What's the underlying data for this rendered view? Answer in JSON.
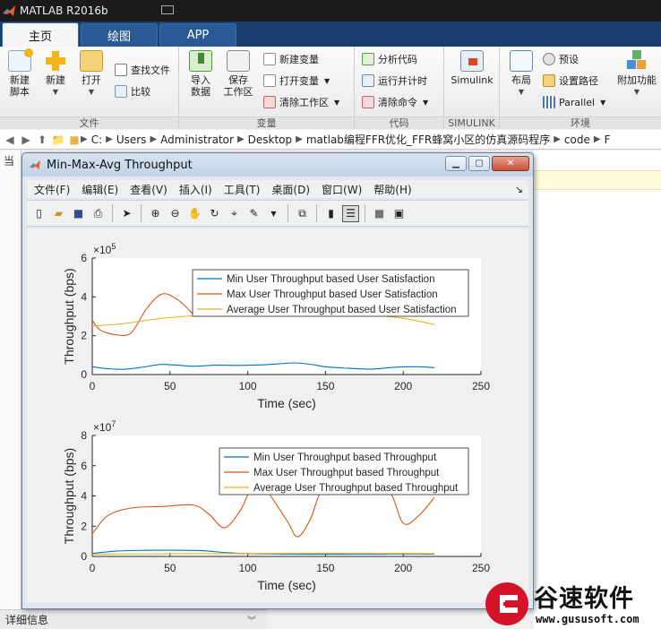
{
  "app": {
    "title": "MATLAB R2016b"
  },
  "ribbon": {
    "tabs": [
      "主页",
      "绘图",
      "APP"
    ],
    "file": {
      "label": "文件",
      "new_script": "新建\n脚本",
      "new": "新建",
      "open": "打开",
      "find_files": "查找文件",
      "compare": "比较"
    },
    "variable": {
      "label": "变量",
      "import": "导入\n数据",
      "save_ws": "保存\n工作区",
      "new_var": "新建变量",
      "open_var": "打开变量",
      "clear_ws": "清除工作区"
    },
    "code": {
      "label": "代码",
      "analyze": "分析代码",
      "run_time": "运行并计时",
      "clear_cmd": "清除命令"
    },
    "simulink": {
      "label": "SIMULINK",
      "button": "Simulink"
    },
    "env": {
      "label": "环境",
      "layout": "布局",
      "prefs": "预设",
      "set_path": "设置路径",
      "parallel": "Parallel",
      "addons": "附加功能"
    }
  },
  "address": {
    "crumbs": [
      "C:",
      "Users",
      "Administrator",
      "Desktop",
      "matlab编程FFR优化_FFR蜂窝小区的仿真源码程序",
      "code",
      "F"
    ]
  },
  "background": {
    "current_folder_label": "当",
    "details": "详细信息"
  },
  "figure": {
    "title": "Min-Max-Avg Throughput",
    "menu": [
      "文件(F)",
      "编辑(E)",
      "查看(V)",
      "插入(I)",
      "工具(T)",
      "桌面(D)",
      "窗口(W)",
      "帮助(H)"
    ]
  },
  "chart_data": [
    {
      "type": "line",
      "xlabel": "Time (sec)",
      "ylabel": "Throughput (bps)",
      "exponent": "×10^5",
      "xlim": [
        0,
        250
      ],
      "ylim": [
        0,
        600000
      ],
      "xticks": [
        0,
        50,
        100,
        150,
        200,
        250
      ],
      "yticks": [
        "0",
        "2",
        "4",
        "6"
      ],
      "legend_position": "top-right",
      "series": [
        {
          "name": "Min User Throughput based User Satisfaction",
          "color": "#0072bd",
          "x": [
            0,
            10,
            20,
            30,
            40,
            45,
            55,
            65,
            80,
            95,
            110,
            120,
            130,
            140,
            150,
            165,
            180,
            195,
            210,
            220
          ],
          "y": [
            40000,
            30000,
            27000,
            35000,
            48000,
            52000,
            48000,
            43000,
            48000,
            47000,
            50000,
            55000,
            60000,
            53000,
            40000,
            32000,
            28000,
            38000,
            40000,
            35000
          ]
        },
        {
          "name": "Max User Throughput based User Satisfaction",
          "color": "#d95319",
          "x": [
            0,
            5,
            15,
            25,
            35,
            45,
            55,
            65
          ],
          "y": [
            280000,
            230000,
            205000,
            215000,
            340000,
            415000,
            385000,
            310000
          ]
        },
        {
          "name": "Average User Throughput based User Satisfaction",
          "color": "#edb120",
          "x": [
            0,
            20,
            40,
            60,
            80,
            100,
            120,
            140,
            160,
            180,
            200,
            220
          ],
          "y": [
            250000,
            262000,
            285000,
            300000,
            310000,
            315000,
            318000,
            316000,
            312000,
            305000,
            290000,
            258000
          ]
        }
      ]
    },
    {
      "type": "line",
      "xlabel": "Time (sec)",
      "ylabel": "Throughput (bps)",
      "exponent": "×10^7",
      "xlim": [
        0,
        250
      ],
      "ylim": [
        0,
        80000000
      ],
      "xticks": [
        0,
        50,
        100,
        150,
        200,
        250
      ],
      "yticks": [
        "0",
        "2",
        "4",
        "6",
        "8"
      ],
      "legend_position": "top-right",
      "series": [
        {
          "name": "Min User Throughput based Throughput",
          "color": "#0072bd",
          "x": [
            0,
            15,
            30,
            50,
            70,
            85,
            100,
            120,
            150,
            180,
            210,
            220
          ],
          "y": [
            2000000,
            3500000,
            4000000,
            4100000,
            3800000,
            2600000,
            1800000,
            1600000,
            1500000,
            1600000,
            1600000,
            1500000
          ]
        },
        {
          "name": "Max User Throughput based Throughput",
          "color": "#d95319",
          "x": [
            0,
            10,
            25,
            45,
            65,
            75,
            85,
            95,
            102,
            110,
            125,
            132,
            140,
            148,
            160,
            170,
            190,
            200,
            210,
            220
          ],
          "y": [
            15000000,
            27000000,
            32000000,
            33000000,
            34000000,
            28000000,
            19000000,
            30000000,
            44000000,
            46000000,
            24000000,
            13000000,
            24000000,
            44000000,
            44000000,
            44000000,
            44000000,
            22000000,
            27000000,
            39000000
          ]
        },
        {
          "name": "Average User Throughput based Throughput",
          "color": "#edb120",
          "x": [
            0,
            30,
            60,
            100,
            140,
            180,
            220
          ],
          "y": [
            1500000,
            1700000,
            1800000,
            1900000,
            2000000,
            2000000,
            1900000
          ]
        }
      ]
    }
  ],
  "watermark": {
    "text": "谷速软件",
    "url": "www.gususoft.com"
  }
}
